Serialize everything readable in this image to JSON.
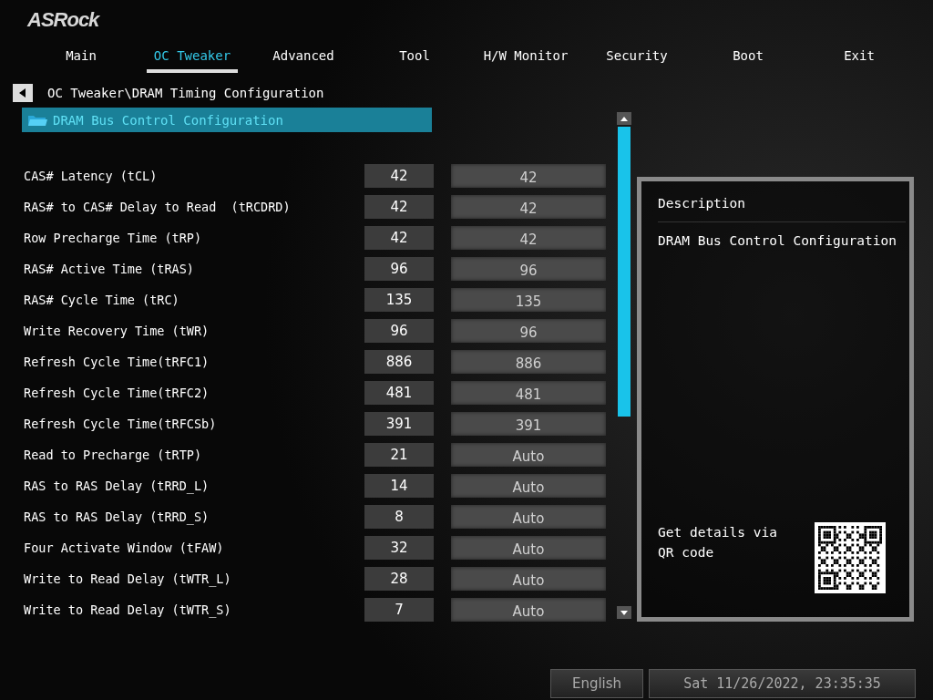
{
  "logo": "ASRock",
  "tabs": [
    {
      "label": "Main",
      "selected": false
    },
    {
      "label": "OC Tweaker",
      "selected": true
    },
    {
      "label": "Advanced",
      "selected": false
    },
    {
      "label": "Tool",
      "selected": false
    },
    {
      "label": "H/W Monitor",
      "selected": false
    },
    {
      "label": "Security",
      "selected": false
    },
    {
      "label": "Boot",
      "selected": false
    },
    {
      "label": "Exit",
      "selected": false
    }
  ],
  "breadcrumb": "OC Tweaker\\DRAM Timing Configuration",
  "submenu": {
    "label": "DRAM Bus Control Configuration",
    "selected": true
  },
  "settings": [
    {
      "name": "CAS# Latency (tCL)",
      "current": "42",
      "value": "42"
    },
    {
      "name": "RAS# to CAS# Delay to Read  (tRCDRD)",
      "current": "42",
      "value": "42"
    },
    {
      "name": "Row Precharge Time (tRP)",
      "current": "42",
      "value": "42"
    },
    {
      "name": "RAS# Active Time (tRAS)",
      "current": "96",
      "value": "96"
    },
    {
      "name": "RAS# Cycle Time (tRC)",
      "current": "135",
      "value": "135"
    },
    {
      "name": "Write Recovery Time (tWR)",
      "current": "96",
      "value": "96"
    },
    {
      "name": "Refresh Cycle Time(tRFC1)",
      "current": "886",
      "value": "886"
    },
    {
      "name": "Refresh Cycle Time(tRFC2)",
      "current": "481",
      "value": "481"
    },
    {
      "name": "Refresh Cycle Time(tRFCSb)",
      "current": "391",
      "value": "391"
    },
    {
      "name": "Read to Precharge (tRTP)",
      "current": "21",
      "value": "Auto"
    },
    {
      "name": "RAS to RAS Delay (tRRD_L)",
      "current": "14",
      "value": "Auto"
    },
    {
      "name": "RAS to RAS Delay (tRRD_S)",
      "current": "8",
      "value": "Auto"
    },
    {
      "name": "Four Activate Window (tFAW)",
      "current": "32",
      "value": "Auto"
    },
    {
      "name": "Write to Read Delay (tWTR_L)",
      "current": "28",
      "value": "Auto"
    },
    {
      "name": "Write to Read Delay (tWTR_S)",
      "current": "7",
      "value": "Auto"
    }
  ],
  "description": {
    "title": "Description",
    "text": "DRAM Bus Control Configuration",
    "qr_hint": "Get details via QR code"
  },
  "footer": {
    "language": "English",
    "datetime": "Sat 11/26/2022, 23:35:35"
  }
}
